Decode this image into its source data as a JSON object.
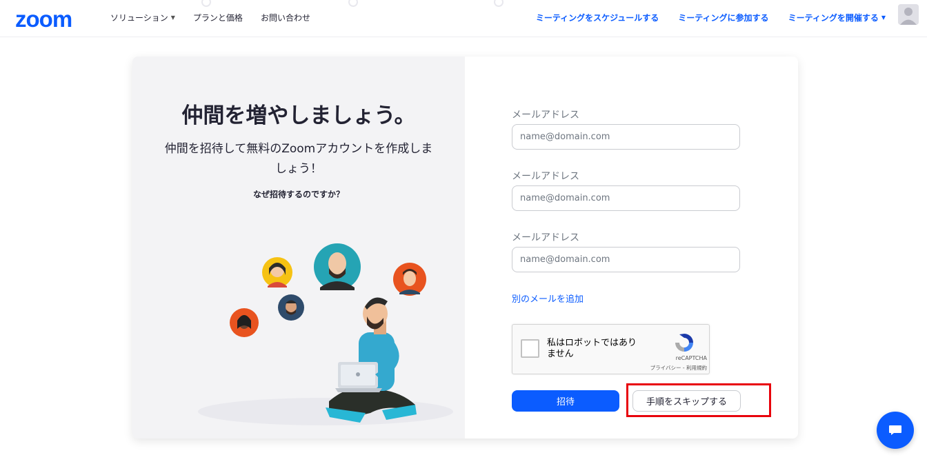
{
  "nav": {
    "logo": "zoom",
    "left_items": [
      {
        "label": "ソリューション",
        "has_caret": true
      },
      {
        "label": "プランと価格",
        "has_caret": false
      },
      {
        "label": "お問い合わせ",
        "has_caret": false
      }
    ],
    "right_items": [
      {
        "label": "ミーティングをスケジュールする",
        "has_caret": false
      },
      {
        "label": "ミーティングに参加する",
        "has_caret": false
      },
      {
        "label": "ミーティングを開催する",
        "has_caret": true
      }
    ],
    "caret_glyph": "▼",
    "avatar_icon": "user-avatar-icon"
  },
  "hero": {
    "title": "仲間を増やしましょう。",
    "subtitle": "仲間を招待して無料のZoomアカウントを作成しましょう！",
    "why_link": "なぜ招待するのですか？"
  },
  "form": {
    "fields": [
      {
        "label": "メールアドレス",
        "placeholder": "name@domain.com",
        "value": ""
      },
      {
        "label": "メールアドレス",
        "placeholder": "name@domain.com",
        "value": ""
      },
      {
        "label": "メールアドレス",
        "placeholder": "name@domain.com",
        "value": ""
      }
    ],
    "add_email_link": "別のメールを追加",
    "captcha": {
      "text": "私はロボットではありません",
      "brand": "reCAPTCHA",
      "links": "プライバシー - 利用規約"
    },
    "invite_button": "招待",
    "skip_button": "手順をスキップする"
  },
  "colors": {
    "brand_blue": "#0b5cff",
    "highlight_red": "#e8000b"
  }
}
